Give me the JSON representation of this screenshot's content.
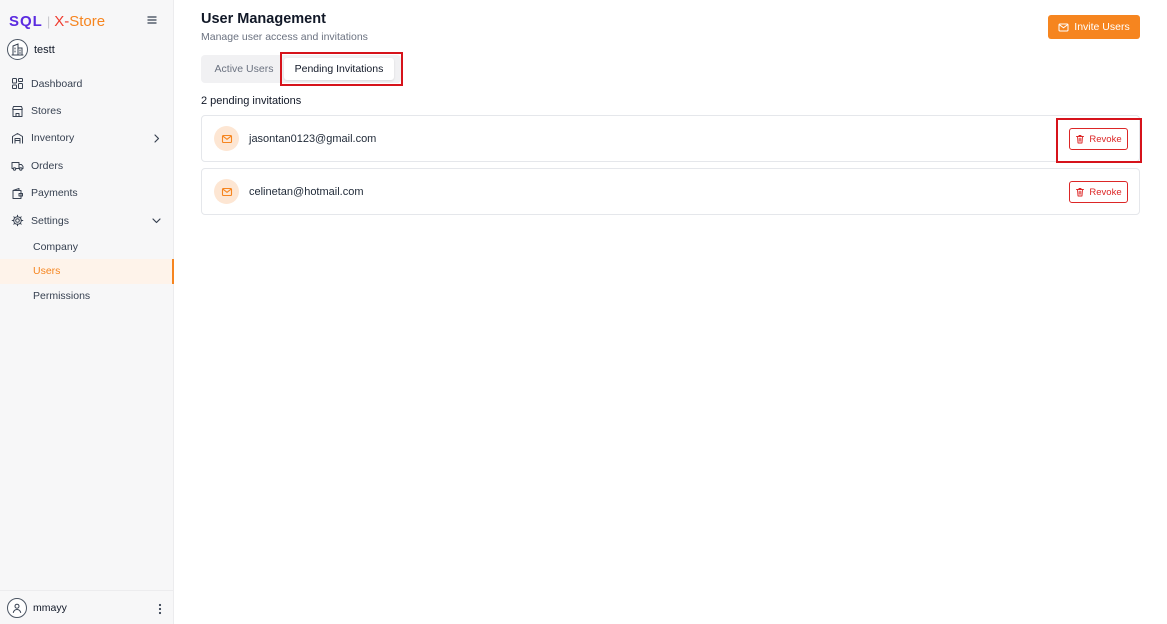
{
  "brand": {
    "sql": "SQL",
    "sep": "|",
    "x": "X-",
    "store": "Store"
  },
  "org": {
    "name": "testt"
  },
  "sidebar": {
    "items": [
      {
        "label": "Dashboard",
        "icon": "dashboard-icon"
      },
      {
        "label": "Stores",
        "icon": "store-icon"
      },
      {
        "label": "Inventory",
        "icon": "warehouse-icon",
        "chevron": "right"
      },
      {
        "label": "Orders",
        "icon": "truck-icon"
      },
      {
        "label": "Payments",
        "icon": "wallet-icon"
      },
      {
        "label": "Settings",
        "icon": "gear-icon",
        "chevron": "down"
      }
    ],
    "sub_items": [
      {
        "label": "Company",
        "active": false
      },
      {
        "label": "Users",
        "active": true
      },
      {
        "label": "Permissions",
        "active": false
      }
    ]
  },
  "user": {
    "name": "mmayy"
  },
  "header": {
    "title": "User Management",
    "subtitle": "Manage user access and invitations",
    "invite_label": "Invite Users"
  },
  "tabs": [
    {
      "label": "Active Users",
      "selected": false
    },
    {
      "label": "Pending Invitations",
      "selected": true
    }
  ],
  "invitations": {
    "count_label": "2 pending invitations",
    "rows": [
      {
        "email": "jasontan0123@gmail.com",
        "action": "Revoke"
      },
      {
        "email": "celinetan@hotmail.com",
        "action": "Revoke"
      }
    ]
  },
  "colors": {
    "accent": "#f6851f",
    "brand_purple": "#5b2be0",
    "danger": "#dc2626",
    "highlight": "#d6131b"
  }
}
